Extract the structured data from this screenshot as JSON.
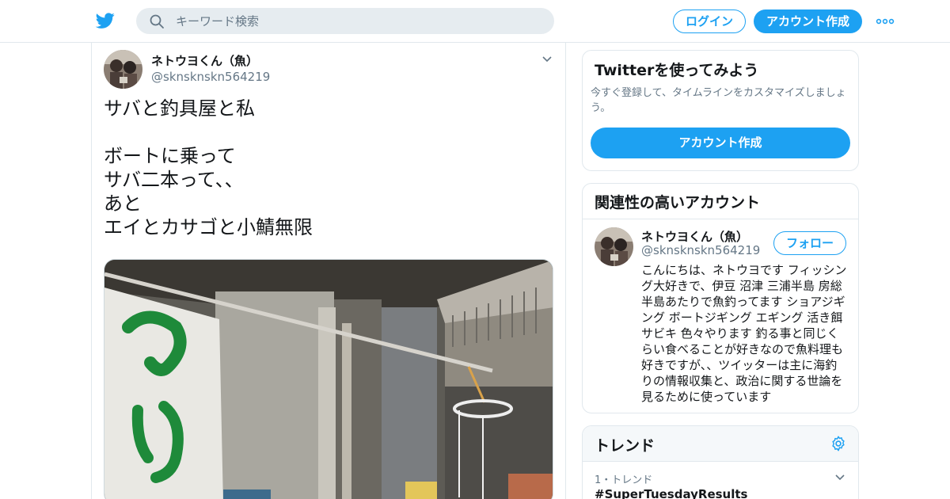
{
  "header": {
    "search_placeholder": "キーワード検索",
    "login_label": "ログイン",
    "signup_label": "アカウント作成",
    "icons": {
      "logo": "twitter-bird-icon",
      "search": "search-icon",
      "more": "more-dots-icon"
    },
    "brand_color": "#1da1f2"
  },
  "tweet": {
    "author_name": "ネトウヨくん（魚）",
    "author_handle": "@sknsknskn564219",
    "text": "サバと釣具屋と私\n\nボートに乗って\nサバ二本って、、\nあと\nエイとカサゴと小鯖無限",
    "media_alt": "fishing tackle shop storefront photo"
  },
  "sidebar": {
    "signup_card": {
      "title": "Twitterを使ってみよう",
      "description": "今すぐ登録して、タイムラインをカスタマイズしましょう。",
      "button_label": "アカウント作成"
    },
    "related": {
      "title": "関連性の高いアカウント",
      "account": {
        "name": "ネトウヨくん（魚）",
        "handle": "@sknsknskn564219",
        "follow_label": "フォロー",
        "bio": "こんにちは、ネトウヨです フィッシング大好きで、伊豆 沼津 三浦半島 房総半島あたりで魚釣ってます ショアジギング ボートジギング エギング 活き餌 サビキ 色々やります 釣る事と同じくらい食べることが好きなので魚料理も好きですが、、ツイッターは主に海釣りの情報収集と、政治に関する世論を見るために使っています"
      }
    },
    "trends": {
      "title": "トレンド",
      "items": [
        {
          "meta": "1・トレンド",
          "name": "#SuperTuesdayResults"
        }
      ]
    }
  }
}
